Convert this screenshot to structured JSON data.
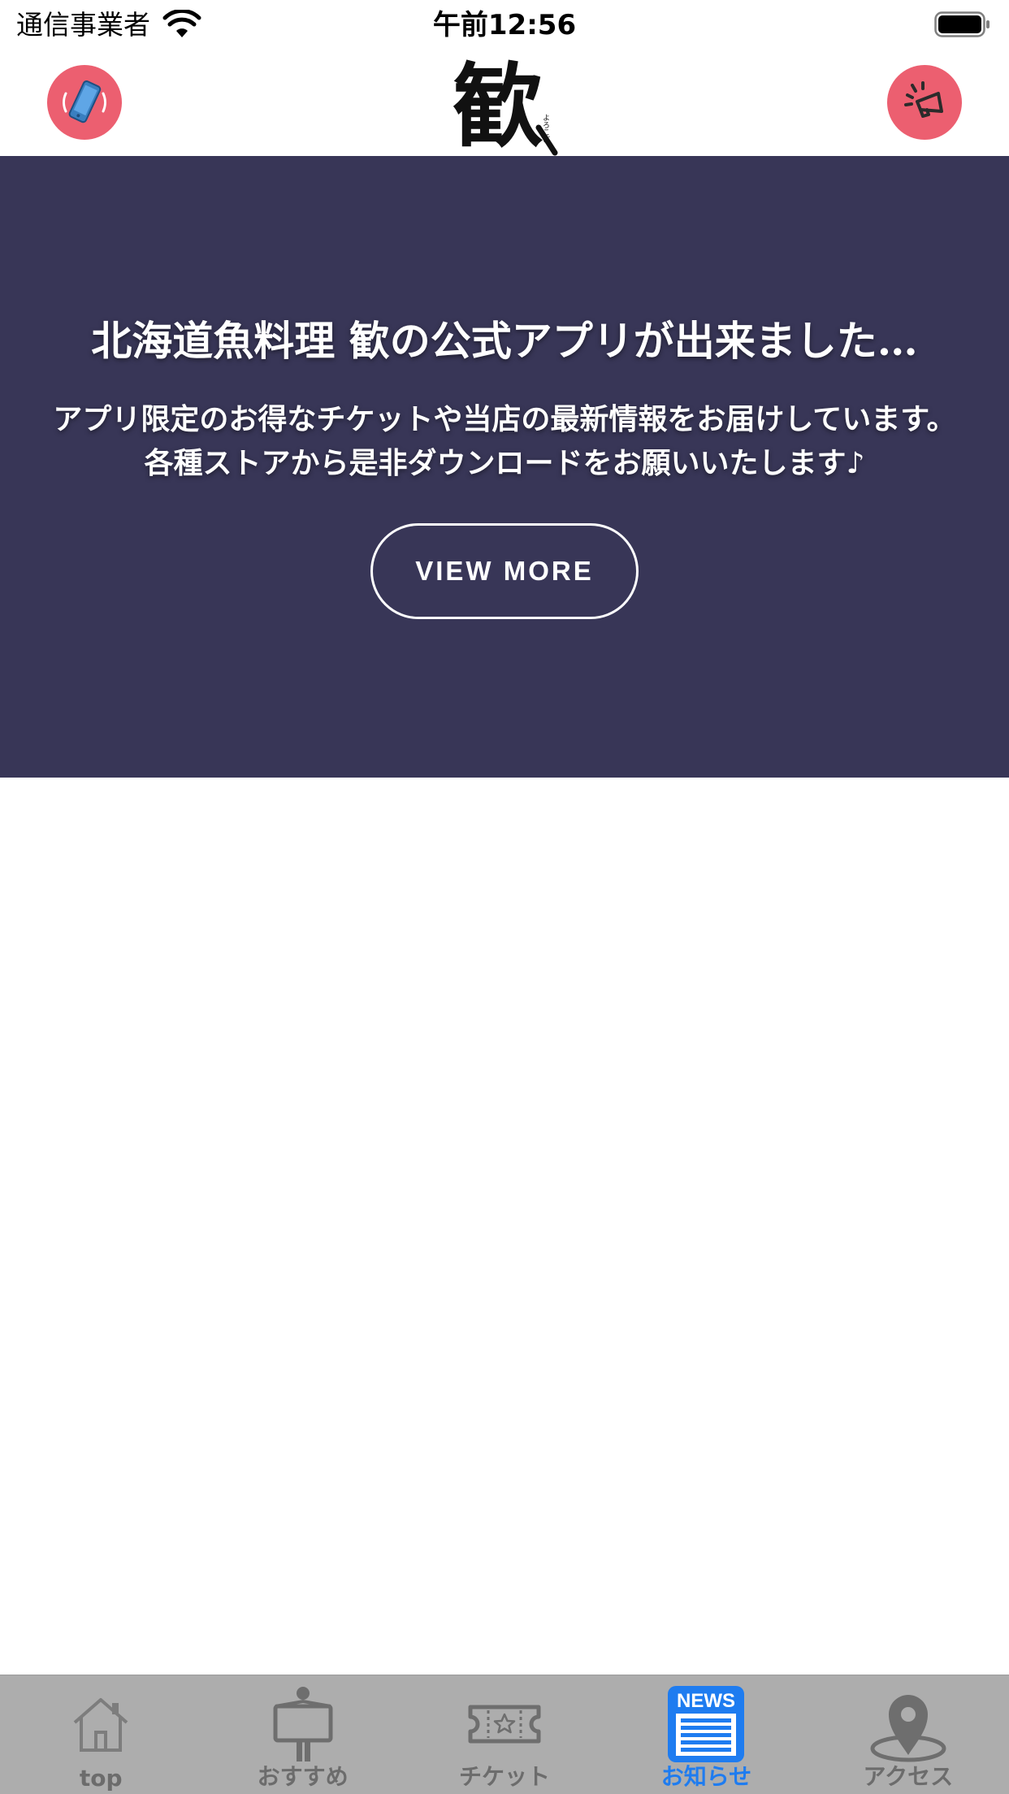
{
  "status_bar": {
    "carrier": "通信事業者",
    "time": "午前12:56"
  },
  "header": {
    "logo_text": "歓",
    "logo_subtext": "よろこび",
    "left_button_icon": "phone-ringing-icon",
    "right_button_icon": "megaphone-icon",
    "accent_color": "#ec5f70"
  },
  "hero": {
    "title": "北海道魚料理 歓の公式アプリが出来ました…",
    "body": "アプリ限定のお得なチケットや当店の最新情報をお届けしています。 各種ストアから是非ダウンロードをお願いいたします♪",
    "button_label": "VIEW MORE",
    "background_color": "#383657"
  },
  "tab_bar": {
    "active_color": "#1e7cf0",
    "items": [
      {
        "label": "top",
        "icon": "home-icon"
      },
      {
        "label": "おすすめ",
        "icon": "signboard-person-icon"
      },
      {
        "label": "チケット",
        "icon": "ticket-icon"
      },
      {
        "label": "お知らせ",
        "icon": "news-icon",
        "icon_text": "NEWS",
        "active": true
      },
      {
        "label": "アクセス",
        "icon": "map-pin-icon"
      }
    ]
  }
}
